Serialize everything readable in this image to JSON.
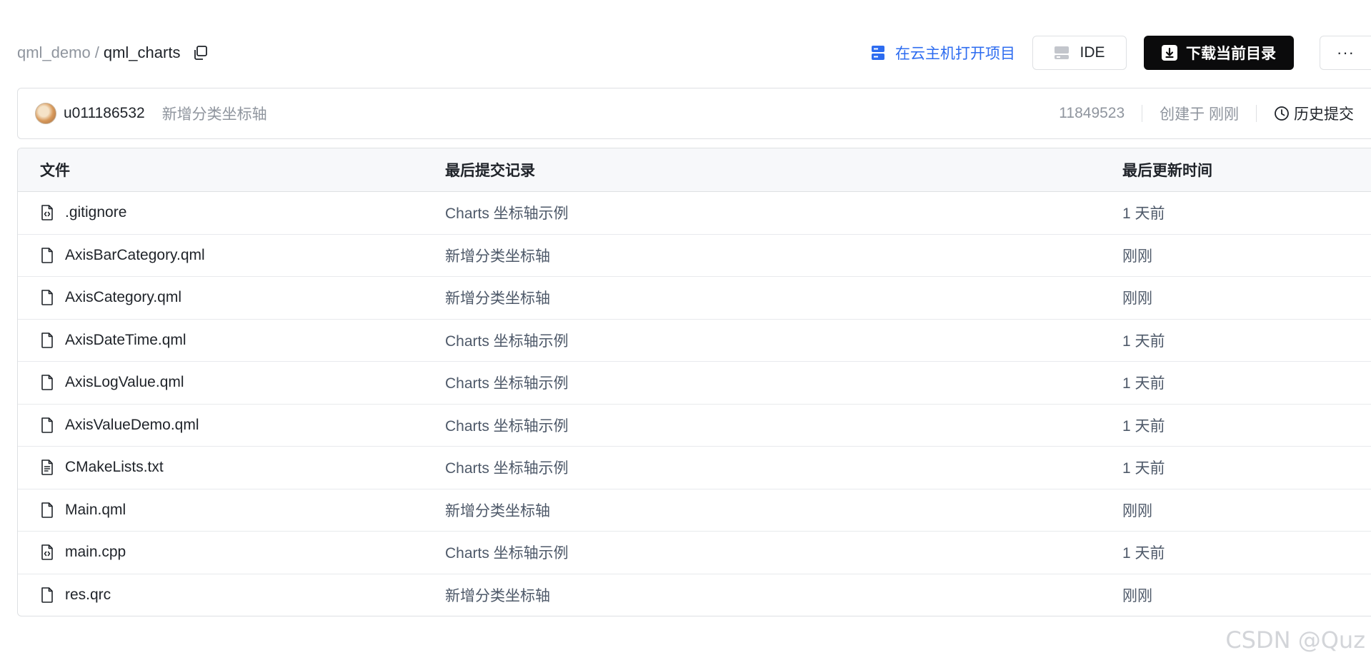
{
  "breadcrumb": {
    "parent": "qml_demo",
    "separator": "/",
    "current": "qml_charts"
  },
  "actions": {
    "cloud_open_label": "在云主机打开项目",
    "ide_label": "IDE",
    "download_label": "下载当前目录",
    "more_label": "···"
  },
  "commit": {
    "user": "u011186532",
    "message": "新增分类坐标轴",
    "sha": "11849523",
    "created": "创建于 刚刚",
    "history_label": "历史提交"
  },
  "table": {
    "headers": {
      "file": "文件",
      "last_commit": "最后提交记录",
      "updated": "最后更新时间"
    },
    "rows": [
      {
        "name": ".gitignore",
        "icon": "code-file-icon",
        "commit": "Charts 坐标轴示例",
        "time": "1 天前"
      },
      {
        "name": "AxisBarCategory.qml",
        "icon": "file-icon",
        "commit": "新增分类坐标轴",
        "time": "刚刚"
      },
      {
        "name": "AxisCategory.qml",
        "icon": "file-icon",
        "commit": "新增分类坐标轴",
        "time": "刚刚"
      },
      {
        "name": "AxisDateTime.qml",
        "icon": "file-icon",
        "commit": "Charts 坐标轴示例",
        "time": "1 天前"
      },
      {
        "name": "AxisLogValue.qml",
        "icon": "file-icon",
        "commit": "Charts 坐标轴示例",
        "time": "1 天前"
      },
      {
        "name": "AxisValueDemo.qml",
        "icon": "file-icon",
        "commit": "Charts 坐标轴示例",
        "time": "1 天前"
      },
      {
        "name": "CMakeLists.txt",
        "icon": "text-file-icon",
        "commit": "Charts 坐标轴示例",
        "time": "1 天前"
      },
      {
        "name": "Main.qml",
        "icon": "file-icon",
        "commit": "新增分类坐标轴",
        "time": "刚刚"
      },
      {
        "name": "main.cpp",
        "icon": "code-file-icon",
        "commit": "Charts 坐标轴示例",
        "time": "1 天前"
      },
      {
        "name": "res.qrc",
        "icon": "file-icon",
        "commit": "新增分类坐标轴",
        "time": "刚刚"
      }
    ]
  },
  "watermark": "CSDN @Quz",
  "colors": {
    "accent_blue": "#2d6cf0",
    "download_bg": "#0b0b0c",
    "muted_text": "#8f959e",
    "border": "#dee0e3",
    "header_bg": "#f7f8fa"
  }
}
